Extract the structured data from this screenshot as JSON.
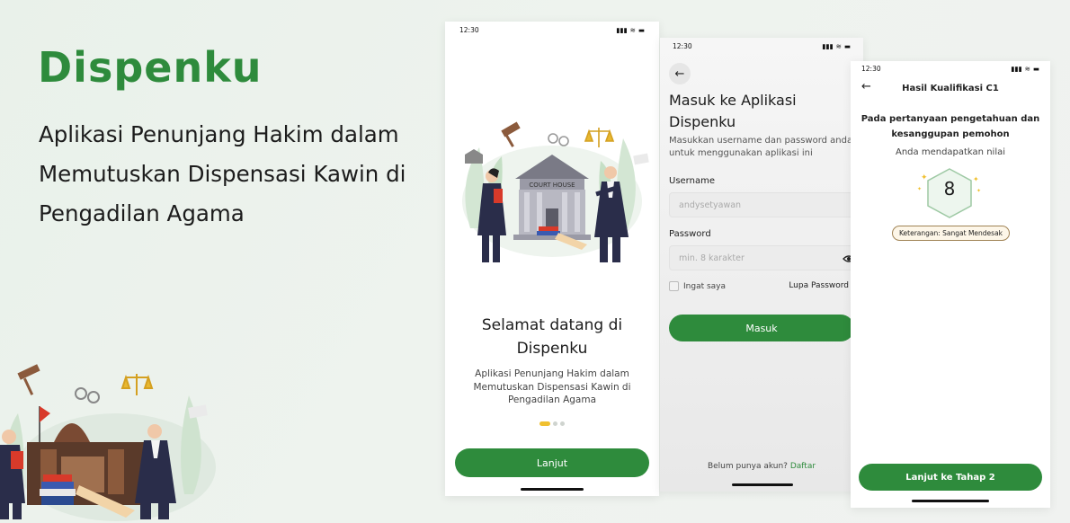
{
  "brand": "Dispenku",
  "tagline": "Aplikasi Penunjang Hakim dalam Memutuskan Dispensasi Kawin di Pengadilan Agama",
  "colors": {
    "primary": "#2e8b3c",
    "accent_dot": "#f0c030"
  },
  "onboarding": {
    "time": "12:30",
    "building_sign": "COURT HOUSE",
    "title": "Selamat datang di Dispenku",
    "description": "Aplikasi Penunjang Hakim dalam Memutuskan Dispensasi Kawin di Pengadilan Agama",
    "dots": 3,
    "button": "Lanjut"
  },
  "login": {
    "time": "12:30",
    "back_icon": "arrow-left-icon",
    "title": "Masuk ke Aplikasi Dispenku",
    "subtitle": "Masukkan username dan password anda untuk menggunakan aplikasi ini",
    "username_label": "Username",
    "username_placeholder": "andysetyawan",
    "password_label": "Password",
    "password_placeholder": "min. 8 karakter",
    "remember_label": "Ingat saya",
    "forgot_label": "Lupa Password",
    "submit_label": "Masuk",
    "signup_prompt": "Belum punya akun?",
    "signup_link": "Daftar"
  },
  "result": {
    "time": "12:30",
    "back_icon": "arrow-left-icon",
    "header": "Hasil Kualifikasi C1",
    "question": "Pada pertanyaan pengetahuan dan kesanggupan pemohon",
    "score_label": "Anda mendapatkan nilai",
    "score": "8",
    "badge": "Keterangan: Sangat Mendesak",
    "next_button": "Lanjut ke Tahap 2"
  }
}
